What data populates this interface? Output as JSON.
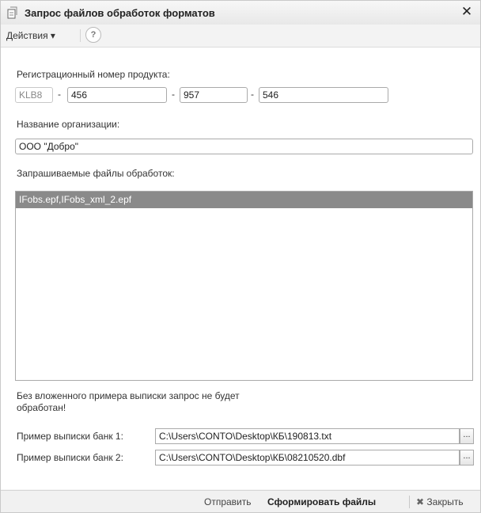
{
  "window": {
    "title": "Запрос файлов обработок форматов",
    "close_glyph": "✕"
  },
  "menubar": {
    "actions_label": "Действия ▾",
    "help_glyph": "?"
  },
  "product": {
    "label": "Регистрационный номер продукта:",
    "prefix": "KLB8",
    "part1": "456",
    "part2": "957",
    "part3": "546",
    "separator": "-"
  },
  "organization": {
    "label": "Название организации:",
    "value": "ООО \"Добро\""
  },
  "files": {
    "label": "Запрашиваемые файлы обработок:",
    "items": [
      "IFobs.epf,IFobs_xml_2.epf"
    ]
  },
  "warning": {
    "line1": "Без вложенного примера выписки запрос не будет",
    "line2": "обработан!"
  },
  "bank1": {
    "label": "Пример выписки банк 1:",
    "path": "C:\\Users\\CONTO\\Desktop\\КБ\\190813.txt",
    "browse_glyph": "..."
  },
  "bank2": {
    "label": "Пример выписки банк 2:",
    "path": "C:\\Users\\CONTO\\Desktop\\КБ\\08210520.dbf",
    "browse_glyph": "..."
  },
  "footer": {
    "send_label": "Отправить",
    "generate_label": "Сформировать файлы",
    "close_label": "Закрыть",
    "close_glyph": "✖"
  }
}
